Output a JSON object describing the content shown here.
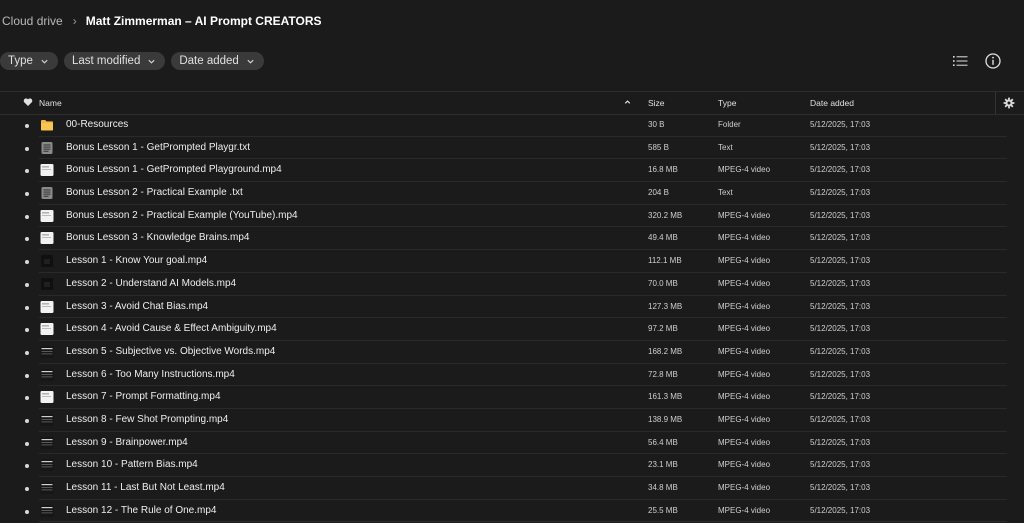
{
  "breadcrumb": {
    "root": "Cloud drive",
    "current": "Matt Zimmerman – AI Prompt CREATORS"
  },
  "filters": {
    "type": "Type",
    "last_modified": "Last modified",
    "date_added": "Date added"
  },
  "icons": {
    "list_view": "list-view-icon",
    "info": "info-icon",
    "settings": "gear-icon",
    "favourite": "heart-icon",
    "sort": "sort-asc-icon"
  },
  "table": {
    "columns": {
      "name": "Name",
      "size": "Size",
      "type": "Type",
      "date_added": "Date added"
    },
    "rows": [
      {
        "name": "00-Resources",
        "size": "30 B",
        "type": "Folder",
        "date": "5/12/2025, 17:03",
        "icon": "folder"
      },
      {
        "name": "Bonus Lesson 1 - GetPrompted Playgr.txt",
        "size": "585 B",
        "type": "Text",
        "date": "5/12/2025, 17:03",
        "icon": "text"
      },
      {
        "name": "Bonus Lesson 1 - GetPrompted Playground.mp4",
        "size": "16.8 MB",
        "type": "MPEG-4 video",
        "date": "5/12/2025, 17:03",
        "icon": "thumb-white"
      },
      {
        "name": "Bonus Lesson 2 - Practical Example .txt",
        "size": "204 B",
        "type": "Text",
        "date": "5/12/2025, 17:03",
        "icon": "text"
      },
      {
        "name": "Bonus Lesson 2 - Practical Example (YouTube).mp4",
        "size": "320.2 MB",
        "type": "MPEG-4 video",
        "date": "5/12/2025, 17:03",
        "icon": "thumb-white"
      },
      {
        "name": "Bonus Lesson 3 - Knowledge Brains.mp4",
        "size": "49.4 MB",
        "type": "MPEG-4 video",
        "date": "5/12/2025, 17:03",
        "icon": "thumb-white"
      },
      {
        "name": "Lesson 1 - Know Your goal.mp4",
        "size": "112.1 MB",
        "type": "MPEG-4 video",
        "date": "5/12/2025, 17:03",
        "icon": "thumb-black"
      },
      {
        "name": "Lesson 2 - Understand AI Models.mp4",
        "size": "70.0 MB",
        "type": "MPEG-4 video",
        "date": "5/12/2025, 17:03",
        "icon": "thumb-black"
      },
      {
        "name": "Lesson 3 - Avoid Chat Bias.mp4",
        "size": "127.3 MB",
        "type": "MPEG-4 video",
        "date": "5/12/2025, 17:03",
        "icon": "thumb-white"
      },
      {
        "name": "Lesson 4 - Avoid Cause & Effect Ambiguity.mp4",
        "size": "97.2 MB",
        "type": "MPEG-4 video",
        "date": "5/12/2025, 17:03",
        "icon": "thumb-white"
      },
      {
        "name": "Lesson 5 - Subjective vs. Objective Words.mp4",
        "size": "168.2 MB",
        "type": "MPEG-4 video",
        "date": "5/12/2025, 17:03",
        "icon": "thumb-dark"
      },
      {
        "name": "Lesson 6 - Too Many Instructions.mp4",
        "size": "72.8 MB",
        "type": "MPEG-4 video",
        "date": "5/12/2025, 17:03",
        "icon": "thumb-dark"
      },
      {
        "name": "Lesson 7 - Prompt Formatting.mp4",
        "size": "161.3 MB",
        "type": "MPEG-4 video",
        "date": "5/12/2025, 17:03",
        "icon": "thumb-white"
      },
      {
        "name": "Lesson 8 - Few Shot Prompting.mp4",
        "size": "138.9 MB",
        "type": "MPEG-4 video",
        "date": "5/12/2025, 17:03",
        "icon": "thumb-dark"
      },
      {
        "name": "Lesson 9 - Brainpower.mp4",
        "size": "56.4 MB",
        "type": "MPEG-4 video",
        "date": "5/12/2025, 17:03",
        "icon": "thumb-dark"
      },
      {
        "name": "Lesson 10 - Pattern Bias.mp4",
        "size": "23.1 MB",
        "type": "MPEG-4 video",
        "date": "5/12/2025, 17:03",
        "icon": "thumb-dark"
      },
      {
        "name": "Lesson 11 - Last But Not Least.mp4",
        "size": "34.8 MB",
        "type": "MPEG-4 video",
        "date": "5/12/2025, 17:03",
        "icon": "thumb-dark"
      },
      {
        "name": "Lesson 12 - The Rule of One.mp4",
        "size": "25.5 MB",
        "type": "MPEG-4 video",
        "date": "5/12/2025, 17:03",
        "icon": "thumb-dark"
      }
    ]
  },
  "colors": {
    "background": "#1b1b1b",
    "chip": "#3a3a3a",
    "folder": "#f4b73d",
    "text": "#eeeeee",
    "muted": "#cfcfcf"
  }
}
